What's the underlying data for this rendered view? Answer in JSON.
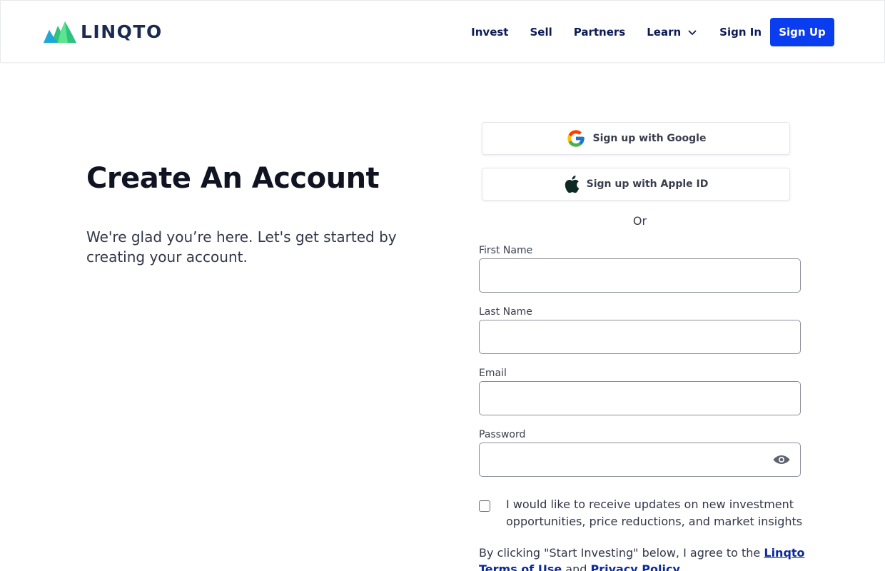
{
  "header": {
    "logo_text": "LINQTO",
    "nav": {
      "invest": "Invest",
      "sell": "Sell",
      "partners": "Partners",
      "learn": "Learn",
      "sign_in": "Sign In",
      "sign_up": "Sign Up"
    }
  },
  "main": {
    "title": "Create An Account",
    "subtitle": "We're glad you’re here. Let's get started by creating your account."
  },
  "form": {
    "google_button": "Sign up with Google",
    "apple_button": "Sign up with Apple ID",
    "or_text": "Or",
    "first_name_label": "First Name",
    "first_name_value": "",
    "last_name_label": "Last Name",
    "last_name_value": "",
    "email_label": "Email",
    "email_value": "",
    "password_label": "Password",
    "password_value": "",
    "updates_checkbox_label": "I would like to receive updates on new investment opportunities, price reductions, and market insights",
    "updates_checked": false,
    "agree_prefix": "By clicking \"Start Investing\" below, I agree to the",
    "terms_link": "Linqto Terms of Use",
    "agree_and": "and",
    "privacy_link": "Privacy Policy",
    "agree_suffix": "."
  },
  "colors": {
    "brand_blue": "#0a3cf0",
    "nav_text": "#0d1b55",
    "link": "#0b2a9c",
    "logo_green": "#3ddc84",
    "logo_teal": "#1fb5c9"
  },
  "icons": {
    "google": "google-icon",
    "apple": "apple-icon",
    "learn_dropdown": "chevron-down-icon",
    "password_toggle": "eye-icon"
  }
}
